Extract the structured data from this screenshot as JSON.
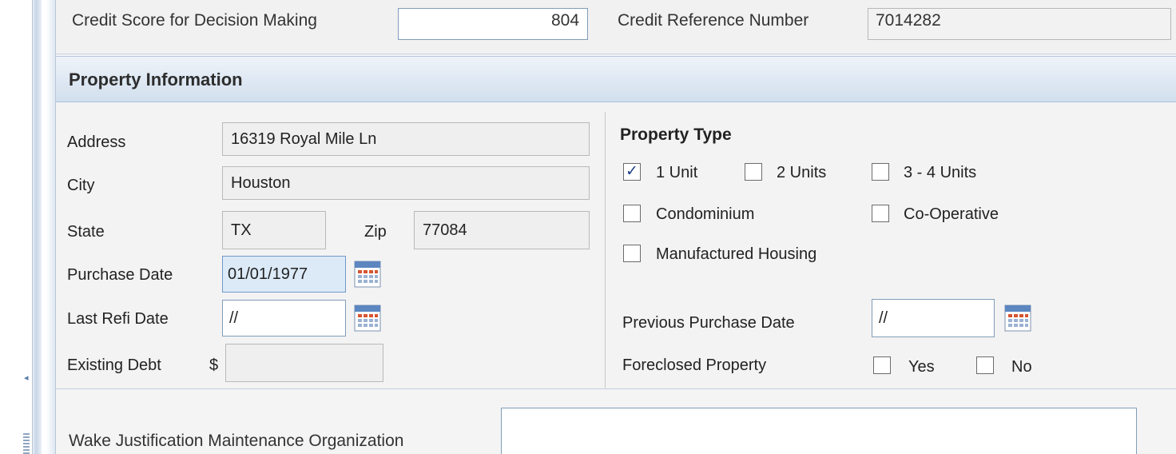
{
  "top_row": {
    "label_1": "Credit Score for Decision Making",
    "value_1": "804",
    "label_2": "Credit Reference Number",
    "value_2": "7014282"
  },
  "section": {
    "title": "Property Information"
  },
  "address": {
    "label": "Address",
    "value": "16319 Royal Mile Ln"
  },
  "city": {
    "label": "City",
    "value": "Houston"
  },
  "state": {
    "label": "State",
    "value": "TX"
  },
  "zip": {
    "label": "Zip",
    "value": "77084"
  },
  "purchase_date": {
    "label": "Purchase Date",
    "value": "01/01/1977"
  },
  "last_refi_date": {
    "label": "Last Refi Date",
    "value": "//"
  },
  "existing_debt": {
    "label": "Existing Debt",
    "currency": "$",
    "value": ""
  },
  "property_type": {
    "title": "Property Type",
    "options": [
      {
        "label": "1 Unit",
        "checked": true
      },
      {
        "label": "2 Units",
        "checked": false
      },
      {
        "label": "3 - 4 Units",
        "checked": false
      },
      {
        "label": "Condominium",
        "checked": false
      },
      {
        "label": "Co-Operative",
        "checked": false
      },
      {
        "label": "Manufactured Housing",
        "checked": false
      }
    ]
  },
  "previous_purchase_date": {
    "label": "Previous Purchase Date",
    "value": "//"
  },
  "foreclosed_property": {
    "label": "Foreclosed Property",
    "options": [
      {
        "label": "Yes",
        "checked": false
      },
      {
        "label": "No",
        "checked": false
      }
    ]
  },
  "bottom_row": {
    "label": "Wake Justification Maintenance Organization",
    "value": ""
  },
  "icons": {
    "calendar": "calendar-icon",
    "check": "✓",
    "left_arrow": "◂"
  }
}
